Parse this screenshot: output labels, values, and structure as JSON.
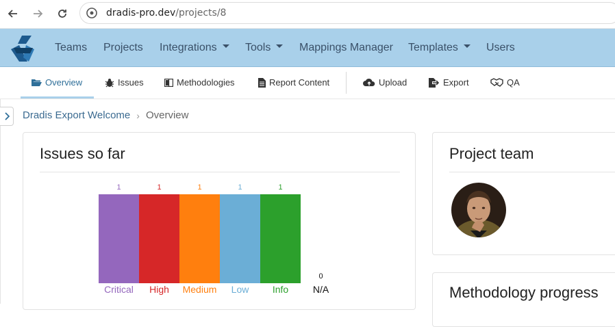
{
  "browser": {
    "url_host": "dradis-pro.dev",
    "url_path": "/projects/8"
  },
  "navbar": {
    "items": [
      {
        "label": "Teams",
        "dropdown": false
      },
      {
        "label": "Projects",
        "dropdown": false
      },
      {
        "label": "Integrations",
        "dropdown": true
      },
      {
        "label": "Tools",
        "dropdown": true
      },
      {
        "label": "Mappings Manager",
        "dropdown": false
      },
      {
        "label": "Templates",
        "dropdown": true
      },
      {
        "label": "Users",
        "dropdown": false
      }
    ]
  },
  "subnav": {
    "items": [
      {
        "label": "Overview",
        "icon": "folder-open-icon",
        "active": true
      },
      {
        "label": "Issues",
        "icon": "bug-icon"
      },
      {
        "label": "Methodologies",
        "icon": "book-icon"
      },
      {
        "label": "Report Content",
        "icon": "file-icon"
      },
      {
        "label": "Upload",
        "icon": "cloud-upload-icon"
      },
      {
        "label": "Export",
        "icon": "export-icon"
      },
      {
        "label": "QA",
        "icon": "handshake-icon"
      }
    ]
  },
  "breadcrumb": {
    "project": "Dradis Export Welcome",
    "current": "Overview"
  },
  "issues_card": {
    "title": "Issues so far"
  },
  "team_card": {
    "title": "Project team"
  },
  "methodology_card": {
    "title": "Methodology progress"
  },
  "chart_data": {
    "type": "bar",
    "categories": [
      "Critical",
      "High",
      "Medium",
      "Low",
      "Info",
      "N/A"
    ],
    "values": [
      1,
      1,
      1,
      1,
      1,
      0
    ],
    "colors": [
      "#9467bd",
      "#d62728",
      "#ff7f0e",
      "#6baed6",
      "#2ca02c",
      "#333333"
    ],
    "label_colors": [
      "#9467bd",
      "#d62728",
      "#ff7f0e",
      "#6baed6",
      "#2ca02c",
      "#111111"
    ],
    "ylim": [
      0,
      1
    ]
  }
}
